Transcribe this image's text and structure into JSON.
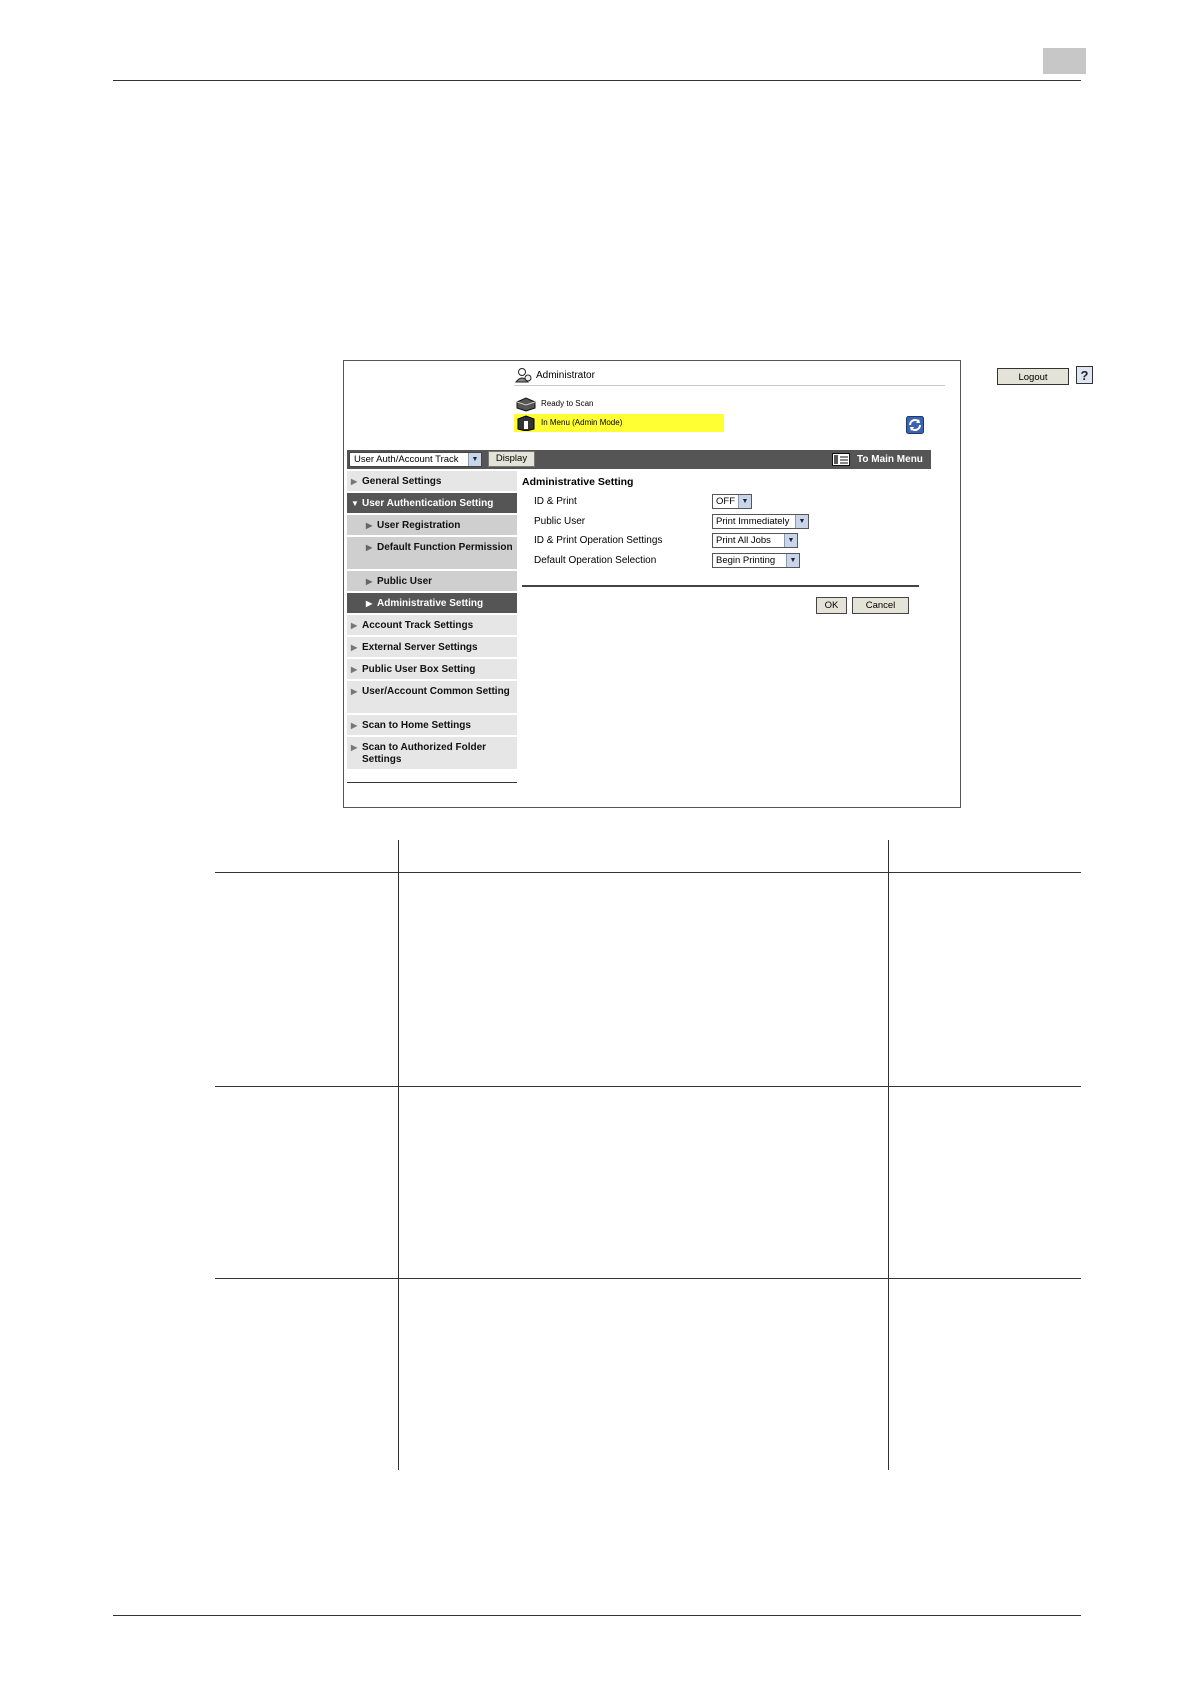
{
  "header": {
    "user_label": "Administrator",
    "logout_label": "Logout",
    "help_label": "?"
  },
  "status": {
    "line1": "Ready to Scan",
    "line2": "In Menu (Admin Mode)"
  },
  "navbar": {
    "category_select": "User Auth/Account Track",
    "display_label": "Display",
    "main_menu_label": "To Main Menu"
  },
  "sidebar": {
    "items": [
      {
        "label": "General Settings"
      },
      {
        "label": "User Authentication Setting"
      },
      {
        "label": "User Registration"
      },
      {
        "label": "Default Function Permission"
      },
      {
        "label": "Public User"
      },
      {
        "label": "Administrative Setting"
      },
      {
        "label": "Account Track Settings"
      },
      {
        "label": "External Server Settings"
      },
      {
        "label": "Public User Box Setting"
      },
      {
        "label": "User/Account Common Setting"
      },
      {
        "label": "Scan to Home Settings"
      },
      {
        "label": "Scan to Authorized Folder Settings"
      }
    ]
  },
  "content": {
    "title": "Administrative Setting",
    "fields": [
      {
        "label": "ID & Print",
        "value": "OFF"
      },
      {
        "label": "Public User",
        "value": "Print Immediately"
      },
      {
        "label": "ID & Print Operation Settings",
        "value": "Print All Jobs"
      },
      {
        "label": "Default Operation Selection",
        "value": "Begin Printing"
      }
    ],
    "ok_label": "OK",
    "cancel_label": "Cancel"
  },
  "colors": {
    "highlight": "#ffff33",
    "nav_dark": "#555555",
    "sidebar_light": "#e6e6e6"
  }
}
